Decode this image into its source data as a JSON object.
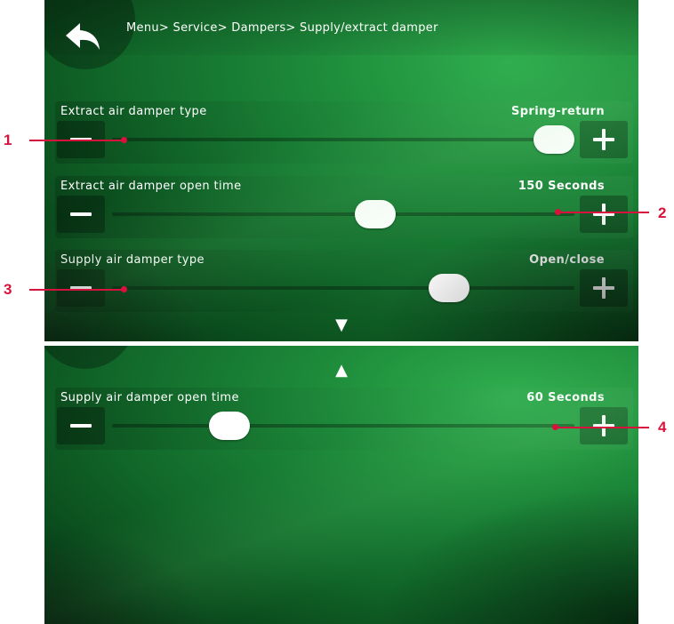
{
  "breadcrumb": "Menu> Service> Dampers> Supply/extract damper",
  "icons": {
    "back": "back-arrow-icon",
    "scroll_down": "triangle-down-icon",
    "scroll_up": "triangle-up-icon"
  },
  "settings": [
    {
      "label": "Extract air damper type",
      "value": "Spring-return",
      "level": 1.0
    },
    {
      "label": "Extract air damper open time",
      "value": "150 Seconds",
      "level": 0.62
    },
    {
      "label": "Supply air damper type",
      "value": "Open/close",
      "level": 0.8
    },
    {
      "label": "Supply air damper open time",
      "value": "60 Seconds",
      "level": 0.28
    }
  ],
  "arrows": {
    "down": "▼",
    "up": "▲"
  },
  "callouts": [
    "1",
    "2",
    "3",
    "4"
  ],
  "colors": {
    "callout": "#d8123c",
    "background": "#1d8a3a"
  }
}
